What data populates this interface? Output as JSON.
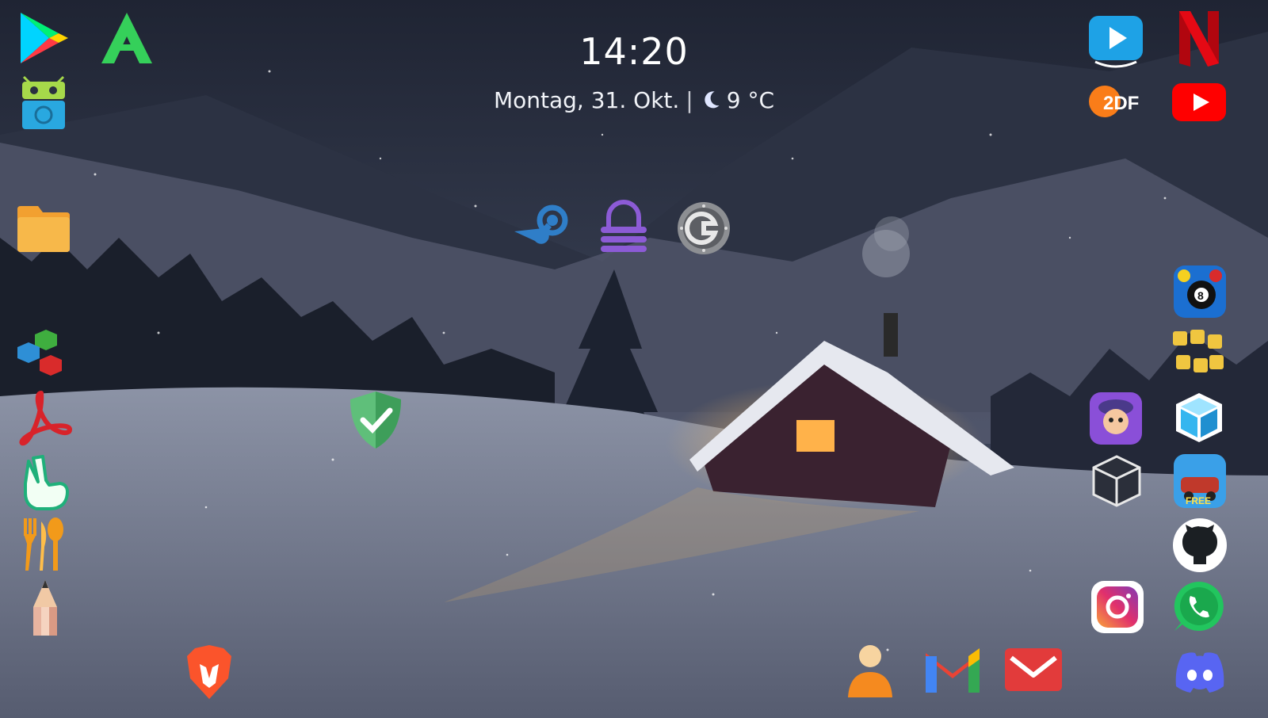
{
  "status": {
    "time": "14:20",
    "date": "Montag, 31. Okt.",
    "separator": "|",
    "temperature": "9 °C",
    "weather_icon": "moon-icon"
  },
  "wallpaper": {
    "scene": "winter-cabin-night",
    "colors": {
      "sky": "#2a3040",
      "snow": "#d8dce6",
      "window_glow": "#ffb24a"
    }
  },
  "apps": [
    {
      "id": "google-play",
      "icon": "play-store-icon"
    },
    {
      "id": "aptoide",
      "icon": "aptoide-icon"
    },
    {
      "id": "android-robot-app",
      "icon": "android-robot-icon"
    },
    {
      "id": "files",
      "icon": "folder-icon"
    },
    {
      "id": "cube-app",
      "icon": "cubes-icon"
    },
    {
      "id": "acrobat",
      "icon": "acrobat-icon"
    },
    {
      "id": "peace-hand",
      "icon": "peace-hand-icon"
    },
    {
      "id": "food",
      "icon": "cutlery-icon"
    },
    {
      "id": "drawing",
      "icon": "pencil-icon"
    },
    {
      "id": "steam",
      "icon": "steam-icon"
    },
    {
      "id": "lock-app",
      "icon": "padlock-icon"
    },
    {
      "id": "authenticator",
      "icon": "authenticator-icon"
    },
    {
      "id": "adguard",
      "icon": "shield-check-icon"
    },
    {
      "id": "brave",
      "icon": "brave-lion-icon"
    },
    {
      "id": "prime-video",
      "icon": "prime-video-icon"
    },
    {
      "id": "netflix",
      "icon": "netflix-icon"
    },
    {
      "id": "zdf",
      "icon": "zdf-icon",
      "label": "2DF"
    },
    {
      "id": "youtube",
      "icon": "youtube-icon"
    },
    {
      "id": "8-ball-pool",
      "icon": "billiards-icon"
    },
    {
      "id": "word-mix",
      "icon": "word-mix-icon"
    },
    {
      "id": "game-character",
      "icon": "game-character-icon"
    },
    {
      "id": "cube-3d",
      "icon": "cube-blue-icon"
    },
    {
      "id": "box-app",
      "icon": "box-outline-icon"
    },
    {
      "id": "racing-game",
      "icon": "racing-game-icon",
      "label": "FREE"
    },
    {
      "id": "github",
      "icon": "github-icon"
    },
    {
      "id": "instagram",
      "icon": "instagram-icon"
    },
    {
      "id": "whatsapp",
      "icon": "whatsapp-icon"
    },
    {
      "id": "contacts",
      "icon": "contacts-icon"
    },
    {
      "id": "gmail",
      "icon": "gmail-icon"
    },
    {
      "id": "mail",
      "icon": "mail-icon"
    },
    {
      "id": "discord",
      "icon": "discord-icon"
    }
  ]
}
